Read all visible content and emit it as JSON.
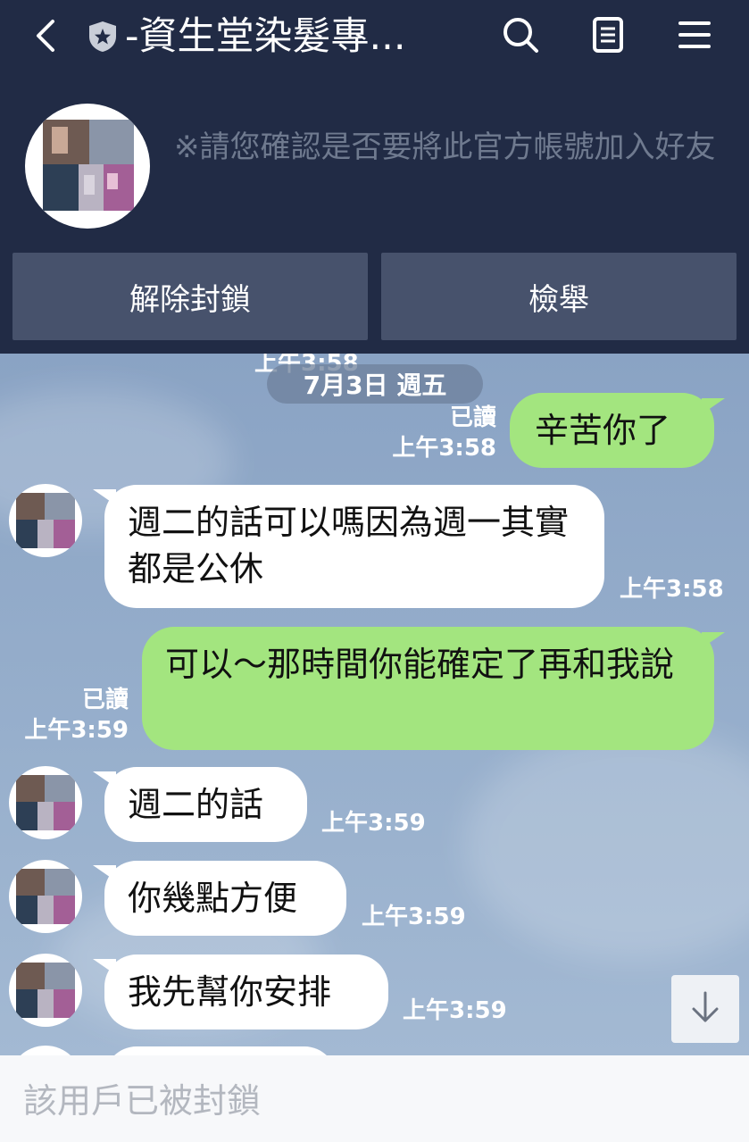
{
  "header": {
    "title": "-資生堂染髮專...",
    "notice": "※請您確認是否要將此官方帳號加入好友",
    "unblock_label": "解除封鎖",
    "report_label": "檢舉",
    "icons": [
      "back-icon",
      "shield-star-icon",
      "search-icon",
      "notes-icon",
      "menu-icon"
    ]
  },
  "chat": {
    "cut_time": "上午3:58",
    "date": "7月3日 週五",
    "messages": [
      {
        "from": "me",
        "text": "辛苦你了",
        "read": "已讀",
        "time": "上午3:58"
      },
      {
        "from": "them",
        "text": "週二的話可以嗎因為週一其實都是公休",
        "time": "上午3:58"
      },
      {
        "from": "me",
        "text": "可以～那時間你能確定了再和我說",
        "read": "已讀",
        "time": "上午3:59"
      },
      {
        "from": "them",
        "text": "週二的話",
        "time": "上午3:59"
      },
      {
        "from": "them",
        "text": "你幾點方便",
        "time": "上午3:59"
      },
      {
        "from": "them",
        "text": "我先幫你安排",
        "time": "上午3:59"
      }
    ]
  },
  "footer": {
    "blocked_text": "該用戶已被封鎖"
  },
  "colors": {
    "header_bg": "#212b45",
    "button_bg": "#47526c",
    "my_bubble": "#a3e57f",
    "their_bubble": "#ffffff",
    "chat_bg": "#8fa9c9"
  }
}
